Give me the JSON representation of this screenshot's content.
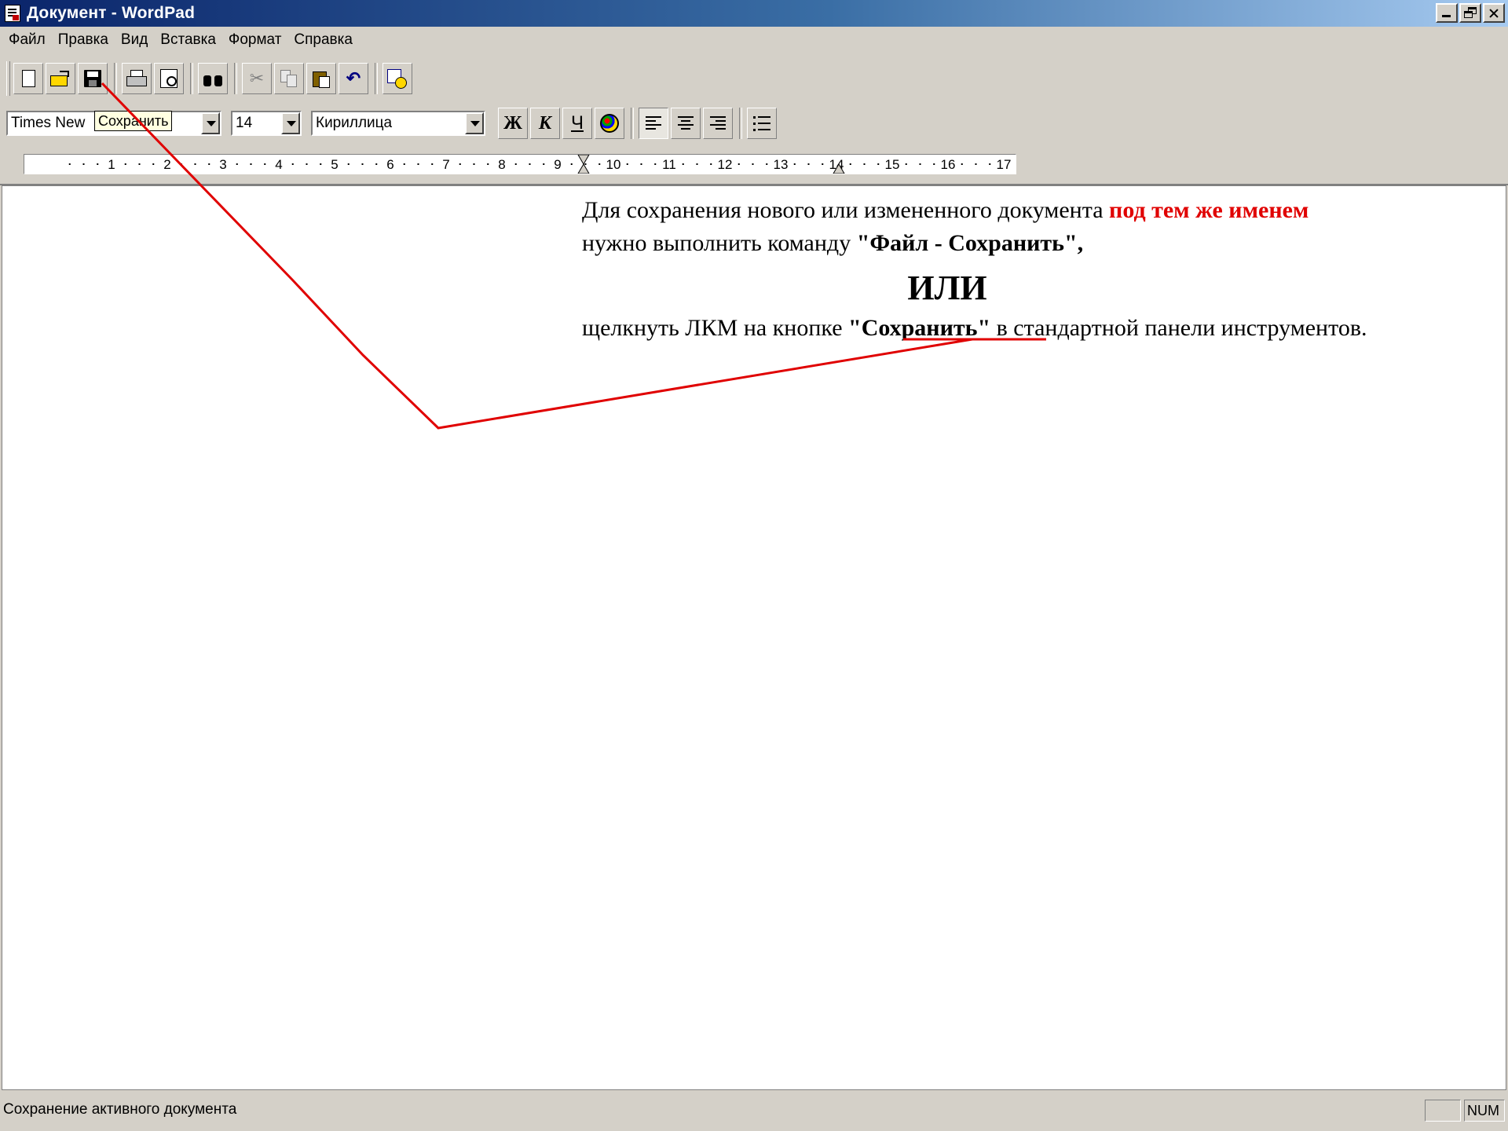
{
  "window": {
    "title": "Документ - WordPad"
  },
  "menu": [
    "Файл",
    "Правка",
    "Вид",
    "Вставка",
    "Формат",
    "Справка"
  ],
  "toolbar": {
    "tooltip": "Сохранить",
    "cut_glyph": "✂",
    "undo_glyph": "↶"
  },
  "format": {
    "font": "Times New",
    "size": "14",
    "script": "Кириллица",
    "bold": "Ж",
    "italic": "К",
    "underline": "Ч"
  },
  "document": {
    "line1_normal": "Для сохранения нового или измененного документа ",
    "line1_red": "под тем же именем",
    "line2_normal": "нужно выполнить команду ",
    "line2_bold": "\"Файл - Сохранить\",",
    "ili": "ИЛИ",
    "line3_a": "щелкнуть ЛКМ на кнопке ",
    "line3_bold": "\"Сохранить\"",
    "line3_b": " в стандартной панели инструментов."
  },
  "status": {
    "text": "Сохранение активного документа",
    "num": "NUM"
  },
  "colors": {
    "title_bar": "#0a246a",
    "annotation": "#e00000",
    "tooltip_bg": "#ffffe1"
  }
}
